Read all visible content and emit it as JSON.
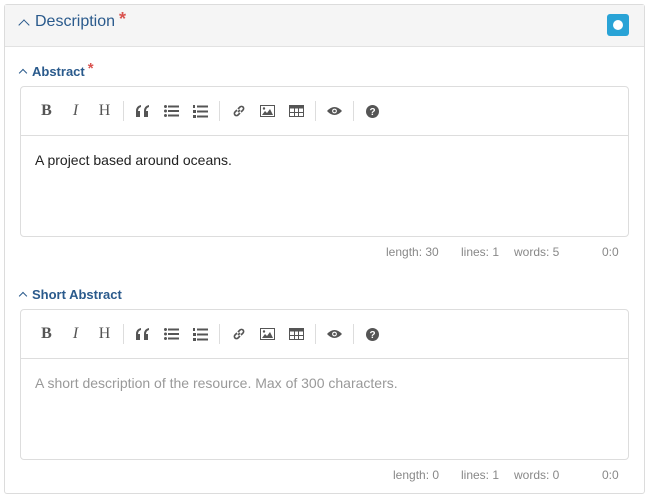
{
  "section": {
    "title": "Description",
    "required_mark": "*"
  },
  "colors": {
    "accent": "#2a5a8c",
    "required": "#d9534f",
    "status_button": "#29a3d6"
  },
  "toolbar_icons": [
    "bold-icon",
    "italic-icon",
    "heading-icon",
    "quote-icon",
    "unordered-list-icon",
    "ordered-list-icon",
    "link-icon",
    "image-icon",
    "table-icon",
    "preview-icon",
    "help-icon"
  ],
  "abstract": {
    "label": "Abstract",
    "required_mark": "*",
    "value": "A project based around oceans.",
    "status": {
      "length": "length: 30",
      "lines": "lines: 1",
      "words": "words: 5",
      "cursor": "0:0"
    }
  },
  "short_abstract": {
    "label": "Short Abstract",
    "placeholder": "A short description of the resource. Max of 300 characters.",
    "status": {
      "length": "length: 0",
      "lines": "lines: 1",
      "words": "words: 0",
      "cursor": "0:0"
    }
  }
}
